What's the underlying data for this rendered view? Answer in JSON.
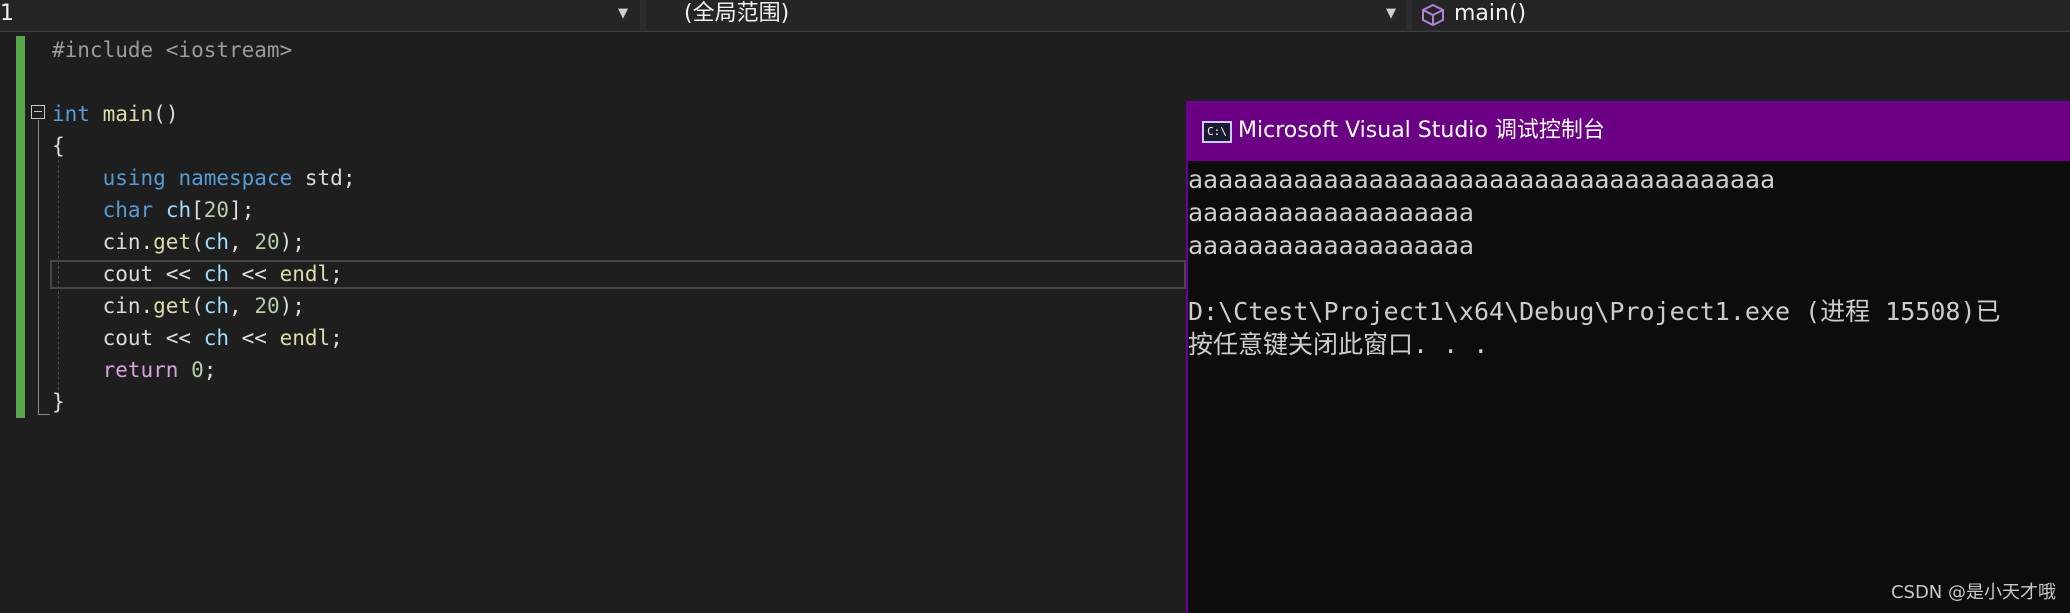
{
  "navbar": {
    "project_selector": "1",
    "scope_selector": "(全局范围)",
    "member_selector": "main()"
  },
  "editor": {
    "code_lines": [
      [
        {
          "t": "#include <iostream>",
          "c": "pp"
        }
      ],
      [],
      [
        {
          "t": "int",
          "c": "ty"
        },
        {
          "t": " ",
          "c": "tx"
        },
        {
          "t": "main",
          "c": "fn"
        },
        {
          "t": "()",
          "c": "tx"
        }
      ],
      [
        {
          "t": "{",
          "c": "tx"
        }
      ],
      [
        {
          "t": "    ",
          "c": "tx"
        },
        {
          "t": "using",
          "c": "kw"
        },
        {
          "t": " ",
          "c": "tx"
        },
        {
          "t": "namespace",
          "c": "kw"
        },
        {
          "t": " std;",
          "c": "tx"
        }
      ],
      [
        {
          "t": "    ",
          "c": "tx"
        },
        {
          "t": "char",
          "c": "ty"
        },
        {
          "t": " ",
          "c": "tx"
        },
        {
          "t": "ch",
          "c": "var"
        },
        {
          "t": "[",
          "c": "tx"
        },
        {
          "t": "20",
          "c": "num"
        },
        {
          "t": "];",
          "c": "tx"
        }
      ],
      [
        {
          "t": "    cin.",
          "c": "tx"
        },
        {
          "t": "get",
          "c": "fn"
        },
        {
          "t": "(",
          "c": "tx"
        },
        {
          "t": "ch",
          "c": "var"
        },
        {
          "t": ", ",
          "c": "tx"
        },
        {
          "t": "20",
          "c": "num"
        },
        {
          "t": ");",
          "c": "tx"
        }
      ],
      [
        {
          "t": "    cout << ",
          "c": "tx"
        },
        {
          "t": "ch",
          "c": "var"
        },
        {
          "t": " << ",
          "c": "tx"
        },
        {
          "t": "endl",
          "c": "fn"
        },
        {
          "t": ";",
          "c": "tx"
        }
      ],
      [
        {
          "t": "    cin.",
          "c": "tx"
        },
        {
          "t": "get",
          "c": "fn"
        },
        {
          "t": "(",
          "c": "tx"
        },
        {
          "t": "ch",
          "c": "var"
        },
        {
          "t": ", ",
          "c": "tx"
        },
        {
          "t": "20",
          "c": "num"
        },
        {
          "t": ");",
          "c": "tx"
        }
      ],
      [
        {
          "t": "    cout << ",
          "c": "tx"
        },
        {
          "t": "ch",
          "c": "var"
        },
        {
          "t": " << ",
          "c": "tx"
        },
        {
          "t": "endl",
          "c": "fn"
        },
        {
          "t": ";",
          "c": "tx"
        }
      ],
      [
        {
          "t": "    ",
          "c": "tx"
        },
        {
          "t": "return",
          "c": "ctl"
        },
        {
          "t": " ",
          "c": "tx"
        },
        {
          "t": "0",
          "c": "num"
        },
        {
          "t": ";",
          "c": "tx"
        }
      ],
      [
        {
          "t": "}",
          "c": "tx"
        }
      ]
    ],
    "current_line": 8
  },
  "console": {
    "title": "Microsoft Visual Studio 调试控制台",
    "icon_label": "C:\\",
    "output": {
      "line1": "aaaaaaaaaaaaaaaaaaaaaaaaaaaaaaaaaaaaaaa",
      "line2": "aaaaaaaaaaaaaaaaaaa",
      "line3": "aaaaaaaaaaaaaaaaaaa",
      "line4": "D:\\Ctest\\Project1\\x64\\Debug\\Project1.exe (进程 15508)已",
      "line5": "按任意键关闭此窗口. . ."
    }
  },
  "watermark": "CSDN @是小天才哦",
  "colors": {
    "change_bar": "#57a64a",
    "console_title_bg": "#6c0084",
    "console_bg": "#0c0c0c",
    "editor_bg": "#1e1e1e"
  },
  "icons": {
    "dropdown": "chevron-down-icon",
    "member": "cube-icon",
    "console": "console-icon",
    "fold": "collapse-icon"
  }
}
